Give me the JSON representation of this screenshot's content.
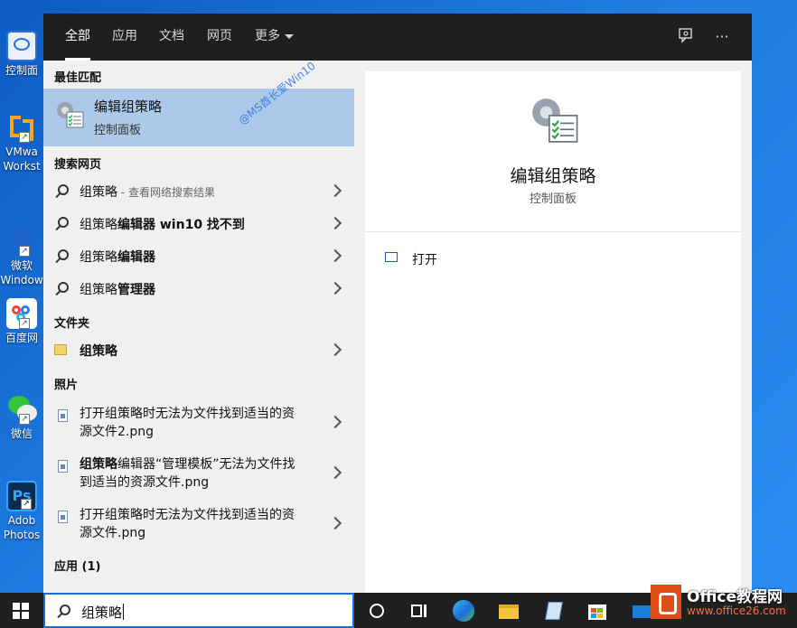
{
  "desktop": {
    "icons": [
      {
        "label": "控制面",
        "color": "#2a6fd6"
      },
      {
        "label": "VMwa",
        "label2": "Workst",
        "color": "#f5a623"
      },
      {
        "label": "微软",
        "label2": "Window",
        "color": "#1e63c9"
      },
      {
        "label": "百度网",
        "color": "#ffffff"
      },
      {
        "label": "微信",
        "color": "#36c23a"
      },
      {
        "label": "Adob",
        "label2": "Photos",
        "color": "#0b2b52"
      }
    ]
  },
  "topbar": {
    "tabs": [
      {
        "label": "全部",
        "active": true
      },
      {
        "label": "应用"
      },
      {
        "label": "文档"
      },
      {
        "label": "网页"
      },
      {
        "label": "更多"
      }
    ],
    "icons": [
      "feedback-icon",
      "more-options-icon"
    ]
  },
  "left": {
    "best_match_header": "最佳匹配",
    "best_match": {
      "title": "编辑组策略",
      "subtitle": "控制面板",
      "icon": "group-policy-icon"
    },
    "watermark": "@MS酋长爱Win10",
    "web_header": "搜索网页",
    "web_items": [
      {
        "prefix": "组策略",
        "bold": "",
        "hint": " - 查看网络搜索结果"
      },
      {
        "prefix": "组策略",
        "bold": "编辑器 win10 找不到",
        "hint": ""
      },
      {
        "prefix": "组策略",
        "bold": "编辑器",
        "hint": ""
      },
      {
        "prefix": "组策略",
        "bold": "管理器",
        "hint": ""
      }
    ],
    "folder_header": "文件夹",
    "folder_items": [
      {
        "label": "组策略",
        "icon": "folder-icon"
      }
    ],
    "photo_header": "照片",
    "photo_items": [
      {
        "bold": "",
        "text": "打开组策略时无法为文件找到适当的资源文件2.png"
      },
      {
        "bold": "组策略",
        "text": "编辑器“管理模板”无法为文件找到适当的资源文件.png"
      },
      {
        "bold": "",
        "text": "打开组策略时无法为文件找到适当的资源文件.png"
      }
    ],
    "apps_header": "应用 (1)"
  },
  "right": {
    "title": "编辑组策略",
    "subtitle": "控制面板",
    "actions": [
      {
        "label": "打开",
        "icon": "open-icon"
      }
    ]
  },
  "taskbar": {
    "search_value": "组策略",
    "icons": [
      "cortana-icon",
      "task-view-icon",
      "edge-icon",
      "file-explorer-icon",
      "notepad-icon",
      "store-icon",
      "mail-icon",
      "office-icon"
    ]
  },
  "office_watermark": {
    "title": "Office教程网",
    "url": "www.office26.com"
  }
}
